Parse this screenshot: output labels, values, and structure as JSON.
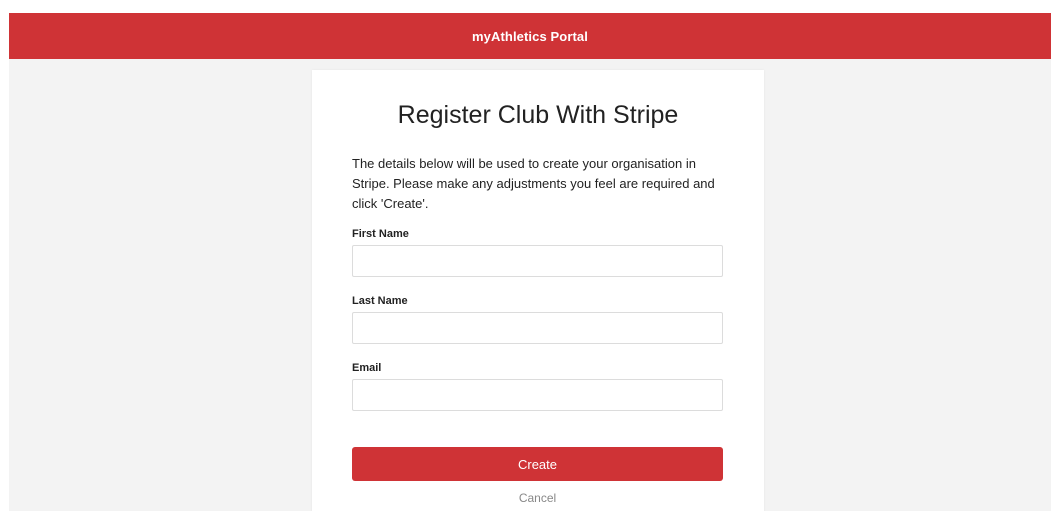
{
  "header": {
    "title": "myAthletics Portal",
    "color": "#cf3336"
  },
  "card": {
    "title": "Register Club With Stripe",
    "intro": "The details below will be used to create your organisation in Stripe. Please make any adjustments you feel are required and click 'Create'."
  },
  "form": {
    "first_name": {
      "label": "First Name",
      "value": ""
    },
    "last_name": {
      "label": "Last Name",
      "value": ""
    },
    "email": {
      "label": "Email",
      "value": ""
    }
  },
  "actions": {
    "create_label": "Create",
    "cancel_label": "Cancel",
    "primary_color": "#cf3336"
  }
}
